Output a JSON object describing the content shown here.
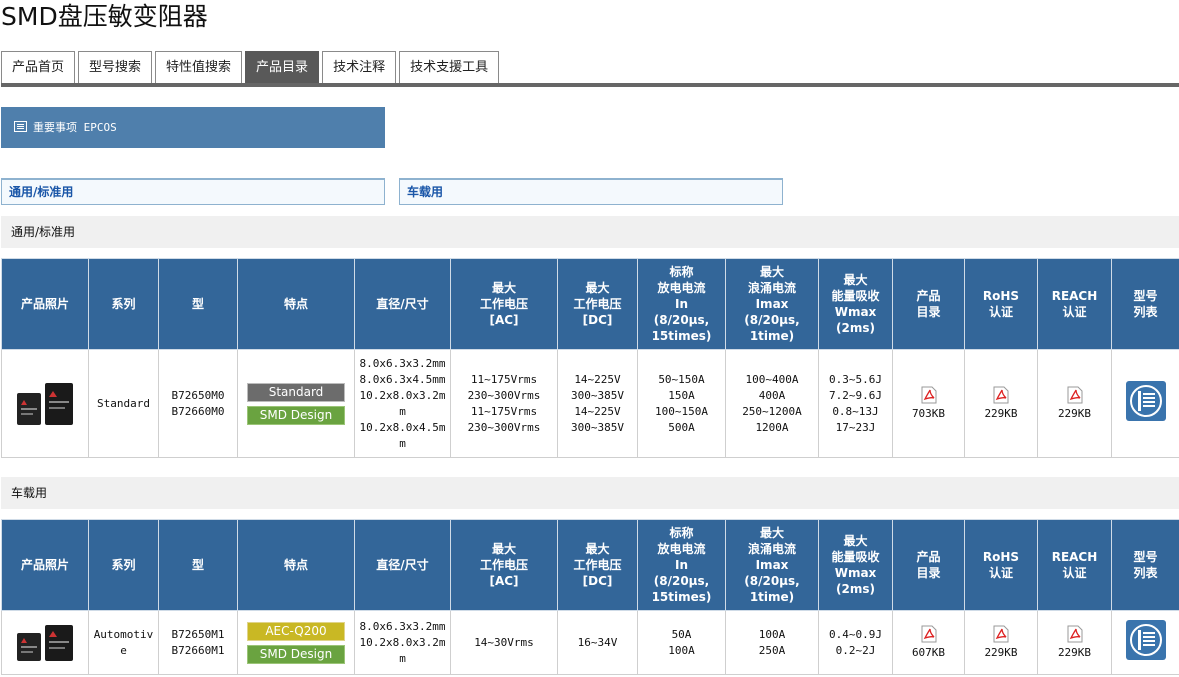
{
  "page_title": "SMD盘压敏变阻器",
  "tabs": [
    "产品首页",
    "型号搜索",
    "特性值搜索",
    "产品目录",
    "技术注释",
    "技术支援工具"
  ],
  "active_tab": 3,
  "notice_label": "重要事项 EPCOS",
  "anchors": [
    "通用/标准用",
    "车载用"
  ],
  "headers": [
    "产品照片",
    "系列",
    "型",
    "特点",
    "直径/尺寸",
    "最大\n工作电压\n[AC]",
    "最大\n工作电压\n[DC]",
    "标称\n放电电流\nIn\n(8/20µs,\n15times)",
    "最大\n浪涌电流\nImax\n(8/20µs,\n1time)",
    "最大\n能量吸收\nWmax\n(2ms)",
    "产品\n目录",
    "RoHS\n认证",
    "REACH\n认证",
    "型号\n列表"
  ],
  "sections": [
    {
      "title": "通用/标准用",
      "row": {
        "series": "Standard",
        "types": "B72650M0\nB72660M0",
        "features": [
          "Standard",
          "SMD Design"
        ],
        "dimensions": "8.0x6.3x3.2mm\n8.0x6.3x4.5mm\n10.2x8.0x3.2mm\n10.2x8.0x4.5mm",
        "vac": "11~175Vrms\n230~300Vrms\n11~175Vrms\n230~300Vrms",
        "vdc": "14~225V\n300~385V\n14~225V\n300~385V",
        "in": "50~150A\n150A\n100~150A\n500A",
        "imax": "100~400A\n400A\n250~1200A\n1200A",
        "wmax": "0.3~5.6J\n7.2~9.6J\n0.8~13J\n17~23J",
        "catalog_size": "703KB",
        "rohs_size": "229KB",
        "reach_size": "229KB"
      }
    },
    {
      "title": "车载用",
      "row": {
        "series": "Automotive",
        "types": "B72650M1\nB72660M1",
        "features": [
          "AEC-Q200",
          "SMD Design"
        ],
        "dimensions": "8.0x6.3x3.2mm\n10.2x8.0x3.2mm",
        "vac": "14~30Vrms",
        "vdc": "16~34V",
        "in": "50A\n100A",
        "imax": "100A\n250A",
        "wmax": "0.4~0.9J\n0.2~2J",
        "catalog_size": "607KB",
        "rohs_size": "229KB",
        "reach_size": "229KB"
      }
    }
  ]
}
